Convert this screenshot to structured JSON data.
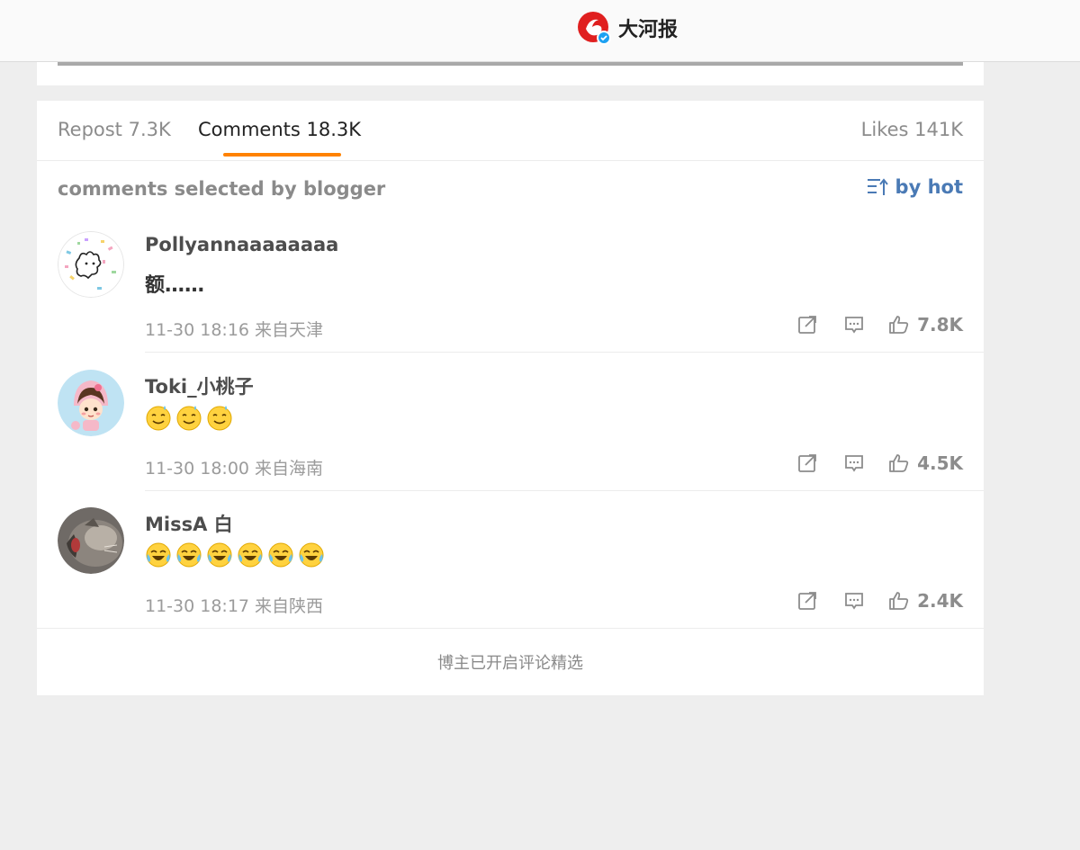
{
  "header": {
    "brand_name": "大河报"
  },
  "tabs": [
    {
      "label": "Repost 7.3K"
    },
    {
      "label": "Comments 18.3K"
    },
    {
      "label": "Likes 141K"
    }
  ],
  "subheader": {
    "label": "comments selected by blogger",
    "sort_label": "by hot"
  },
  "comments": [
    {
      "user": "Pollyannaaaaaaaa",
      "text": "额……",
      "emoji_count": 0,
      "meta": "11-30 18:16 来自天津",
      "likes": "7.8K"
    },
    {
      "user": "Toki_小桃子",
      "text": "",
      "emoji_count": 3,
      "emoji": "smiling-sweat-emoji",
      "meta": "11-30 18:00 来自海南",
      "likes": "4.5K"
    },
    {
      "user": "MissA 白",
      "text": "",
      "emoji_count": 6,
      "emoji": "crying-laughing-emoji",
      "meta": "11-30 18:17 来自陕西",
      "likes": "2.4K"
    }
  ],
  "footer": {
    "note": "博主已开启评论精选"
  },
  "colors": {
    "accent": "#ff8200",
    "link": "#4a7ab5",
    "verified": "#1da1f2"
  }
}
